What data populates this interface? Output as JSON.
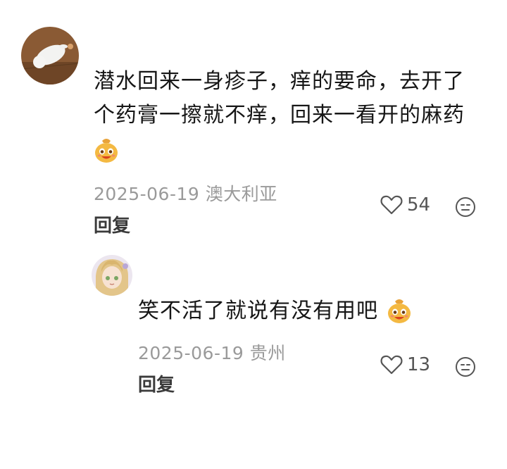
{
  "comment": {
    "text_line1": "潜水回来一身疹子，痒的要命，去开了",
    "text_line2": "个药膏一擦就不痒，回来一看开的麻药",
    "emoji": "smiling-money-bag-emoji",
    "date_location": "2025-06-19 澳大利亚",
    "likes": "54",
    "reply_label": "回复"
  },
  "reply": {
    "text": "笑不活了就说有没有用吧",
    "emoji": "smiling-money-bag-emoji",
    "date_location": "2025-06-19 贵州",
    "likes": "13",
    "reply_label": "回复"
  }
}
